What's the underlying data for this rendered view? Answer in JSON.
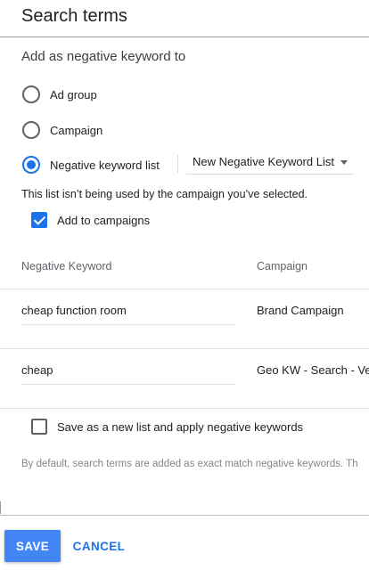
{
  "header": {
    "title": "Search terms"
  },
  "section": {
    "title": "Add as negative keyword to"
  },
  "options": {
    "ad_group": "Ad group",
    "campaign": "Campaign",
    "negative_keyword_list": "Negative keyword list",
    "selected": "negative_keyword_list"
  },
  "list_dropdown": {
    "selected_value": "New Negative Keyword List"
  },
  "notice": "This list isn’t being used by the campaign you’ve selected.",
  "add_to_campaigns": {
    "label": "Add to campaigns",
    "checked": true
  },
  "table": {
    "headers": {
      "keyword": "Negative Keyword",
      "campaign": "Campaign"
    },
    "rows": [
      {
        "keyword": "cheap function room",
        "campaign": "Brand Campaign"
      },
      {
        "keyword": "cheap",
        "campaign": "Geo KW - Search - Ver"
      }
    ]
  },
  "save_new_list": {
    "label": "Save as a new list and apply negative keywords",
    "checked": false
  },
  "footnote": "By default, search terms are added as exact match negative keywords. Th",
  "footer": {
    "save_label": "SAVE",
    "cancel_label": "CANCEL"
  },
  "colors": {
    "accent": "#1a73e8",
    "save_button": "#4285f4"
  }
}
